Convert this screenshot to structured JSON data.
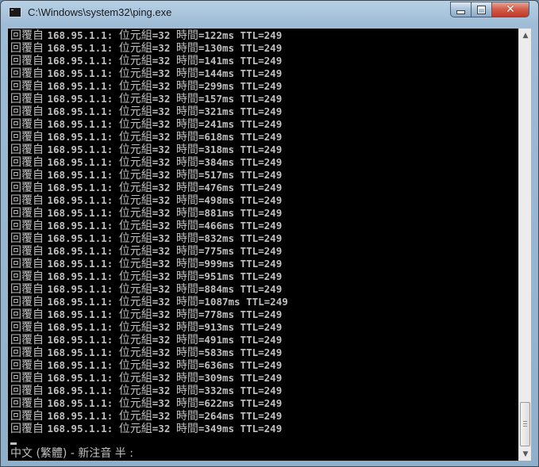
{
  "window": {
    "title": "C:\\Windows\\system32\\ping.exe",
    "app_icon": "console-icon",
    "controls": {
      "minimize_icon": "minimize-icon",
      "maximize_icon": "maximize-icon",
      "close_icon": "close-icon"
    },
    "colors": {
      "console_bg": "#000000",
      "console_text": "#c0c0c0",
      "close_button": "#c0392b"
    }
  },
  "console": {
    "lines": [
      [
        "回覆自 ",
        "168.95.1.1: ",
        "位元組",
        "=32 ",
        "時間",
        "=122ms TTL=249"
      ],
      [
        "回覆自 ",
        "168.95.1.1: ",
        "位元組",
        "=32 ",
        "時間",
        "=130ms TTL=249"
      ],
      [
        "回覆自 ",
        "168.95.1.1: ",
        "位元組",
        "=32 ",
        "時間",
        "=141ms TTL=249"
      ],
      [
        "回覆自 ",
        "168.95.1.1: ",
        "位元組",
        "=32 ",
        "時間",
        "=144ms TTL=249"
      ],
      [
        "回覆自 ",
        "168.95.1.1: ",
        "位元組",
        "=32 ",
        "時間",
        "=299ms TTL=249"
      ],
      [
        "回覆自 ",
        "168.95.1.1: ",
        "位元組",
        "=32 ",
        "時間",
        "=157ms TTL=249"
      ],
      [
        "回覆自 ",
        "168.95.1.1: ",
        "位元組",
        "=32 ",
        "時間",
        "=321ms TTL=249"
      ],
      [
        "回覆自 ",
        "168.95.1.1: ",
        "位元組",
        "=32 ",
        "時間",
        "=241ms TTL=249"
      ],
      [
        "回覆自 ",
        "168.95.1.1: ",
        "位元組",
        "=32 ",
        "時間",
        "=618ms TTL=249"
      ],
      [
        "回覆自 ",
        "168.95.1.1: ",
        "位元組",
        "=32 ",
        "時間",
        "=318ms TTL=249"
      ],
      [
        "回覆自 ",
        "168.95.1.1: ",
        "位元組",
        "=32 ",
        "時間",
        "=384ms TTL=249"
      ],
      [
        "回覆自 ",
        "168.95.1.1: ",
        "位元組",
        "=32 ",
        "時間",
        "=517ms TTL=249"
      ],
      [
        "回覆自 ",
        "168.95.1.1: ",
        "位元組",
        "=32 ",
        "時間",
        "=476ms TTL=249"
      ],
      [
        "回覆自 ",
        "168.95.1.1: ",
        "位元組",
        "=32 ",
        "時間",
        "=498ms TTL=249"
      ],
      [
        "回覆自 ",
        "168.95.1.1: ",
        "位元組",
        "=32 ",
        "時間",
        "=881ms TTL=249"
      ],
      [
        "回覆自 ",
        "168.95.1.1: ",
        "位元組",
        "=32 ",
        "時間",
        "=466ms TTL=249"
      ],
      [
        "回覆自 ",
        "168.95.1.1: ",
        "位元組",
        "=32 ",
        "時間",
        "=832ms TTL=249"
      ],
      [
        "回覆自 ",
        "168.95.1.1: ",
        "位元組",
        "=32 ",
        "時間",
        "=775ms TTL=249"
      ],
      [
        "回覆自 ",
        "168.95.1.1: ",
        "位元組",
        "=32 ",
        "時間",
        "=999ms TTL=249"
      ],
      [
        "回覆自 ",
        "168.95.1.1: ",
        "位元組",
        "=32 ",
        "時間",
        "=951ms TTL=249"
      ],
      [
        "回覆自 ",
        "168.95.1.1: ",
        "位元組",
        "=32 ",
        "時間",
        "=884ms TTL=249"
      ],
      [
        "回覆自 ",
        "168.95.1.1: ",
        "位元組",
        "=32 ",
        "時間",
        "=1087ms TTL=249"
      ],
      [
        "回覆自 ",
        "168.95.1.1: ",
        "位元組",
        "=32 ",
        "時間",
        "=778ms TTL=249"
      ],
      [
        "回覆自 ",
        "168.95.1.1: ",
        "位元組",
        "=32 ",
        "時間",
        "=913ms TTL=249"
      ],
      [
        "回覆自 ",
        "168.95.1.1: ",
        "位元組",
        "=32 ",
        "時間",
        "=491ms TTL=249"
      ],
      [
        "回覆自 ",
        "168.95.1.1: ",
        "位元組",
        "=32 ",
        "時間",
        "=583ms TTL=249"
      ],
      [
        "回覆自 ",
        "168.95.1.1: ",
        "位元組",
        "=32 ",
        "時間",
        "=636ms TTL=249"
      ],
      [
        "回覆自 ",
        "168.95.1.1: ",
        "位元組",
        "=32 ",
        "時間",
        "=309ms TTL=249"
      ],
      [
        "回覆自 ",
        "168.95.1.1: ",
        "位元組",
        "=32 ",
        "時間",
        "=332ms TTL=249"
      ],
      [
        "回覆自 ",
        "168.95.1.1: ",
        "位元組",
        "=32 ",
        "時間",
        "=622ms TTL=249"
      ],
      [
        "回覆自 ",
        "168.95.1.1: ",
        "位元組",
        "=32 ",
        "時間",
        "=264ms TTL=249"
      ],
      [
        "回覆自 ",
        "168.95.1.1: ",
        "位元組",
        "=32 ",
        "時間",
        "=349ms TTL=249"
      ]
    ],
    "ime_status": "中文 (繁體) - 新注音 半 :"
  },
  "scrollbar": {
    "up_icon": "scroll-up-arrow-icon",
    "down_icon": "scroll-down-arrow-icon"
  }
}
